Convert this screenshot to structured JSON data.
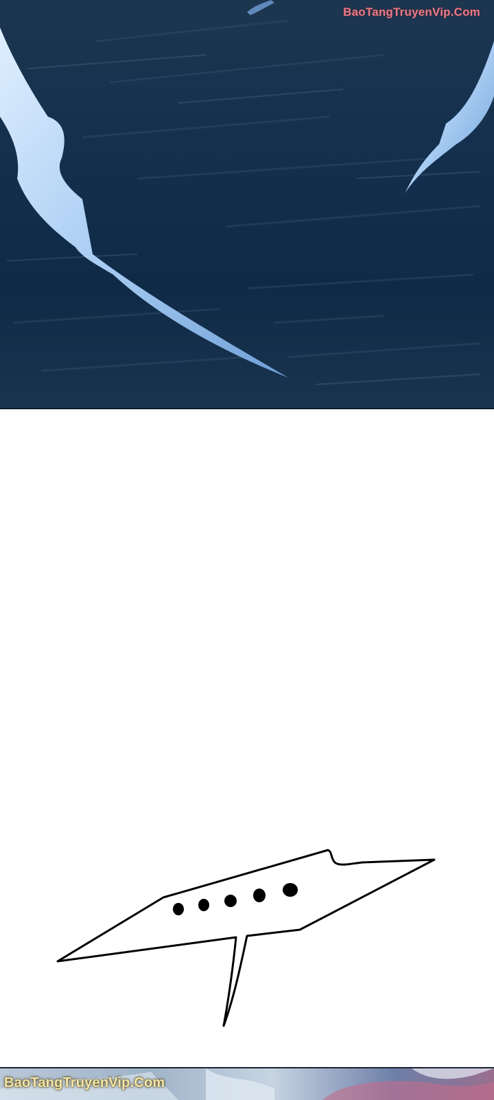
{
  "watermark": {
    "top": "BaoTangTruyenVip.Com",
    "bottom": "BaoTangTruyenVip.Com"
  },
  "speech_bubble": {
    "dots": "....."
  },
  "colors": {
    "night_sky": "#14304e",
    "slash_blue": "#a9cdf3",
    "bubble_border": "#000000",
    "watermark_top": "#e87a88",
    "watermark_bottom": "#f3e6a6"
  }
}
